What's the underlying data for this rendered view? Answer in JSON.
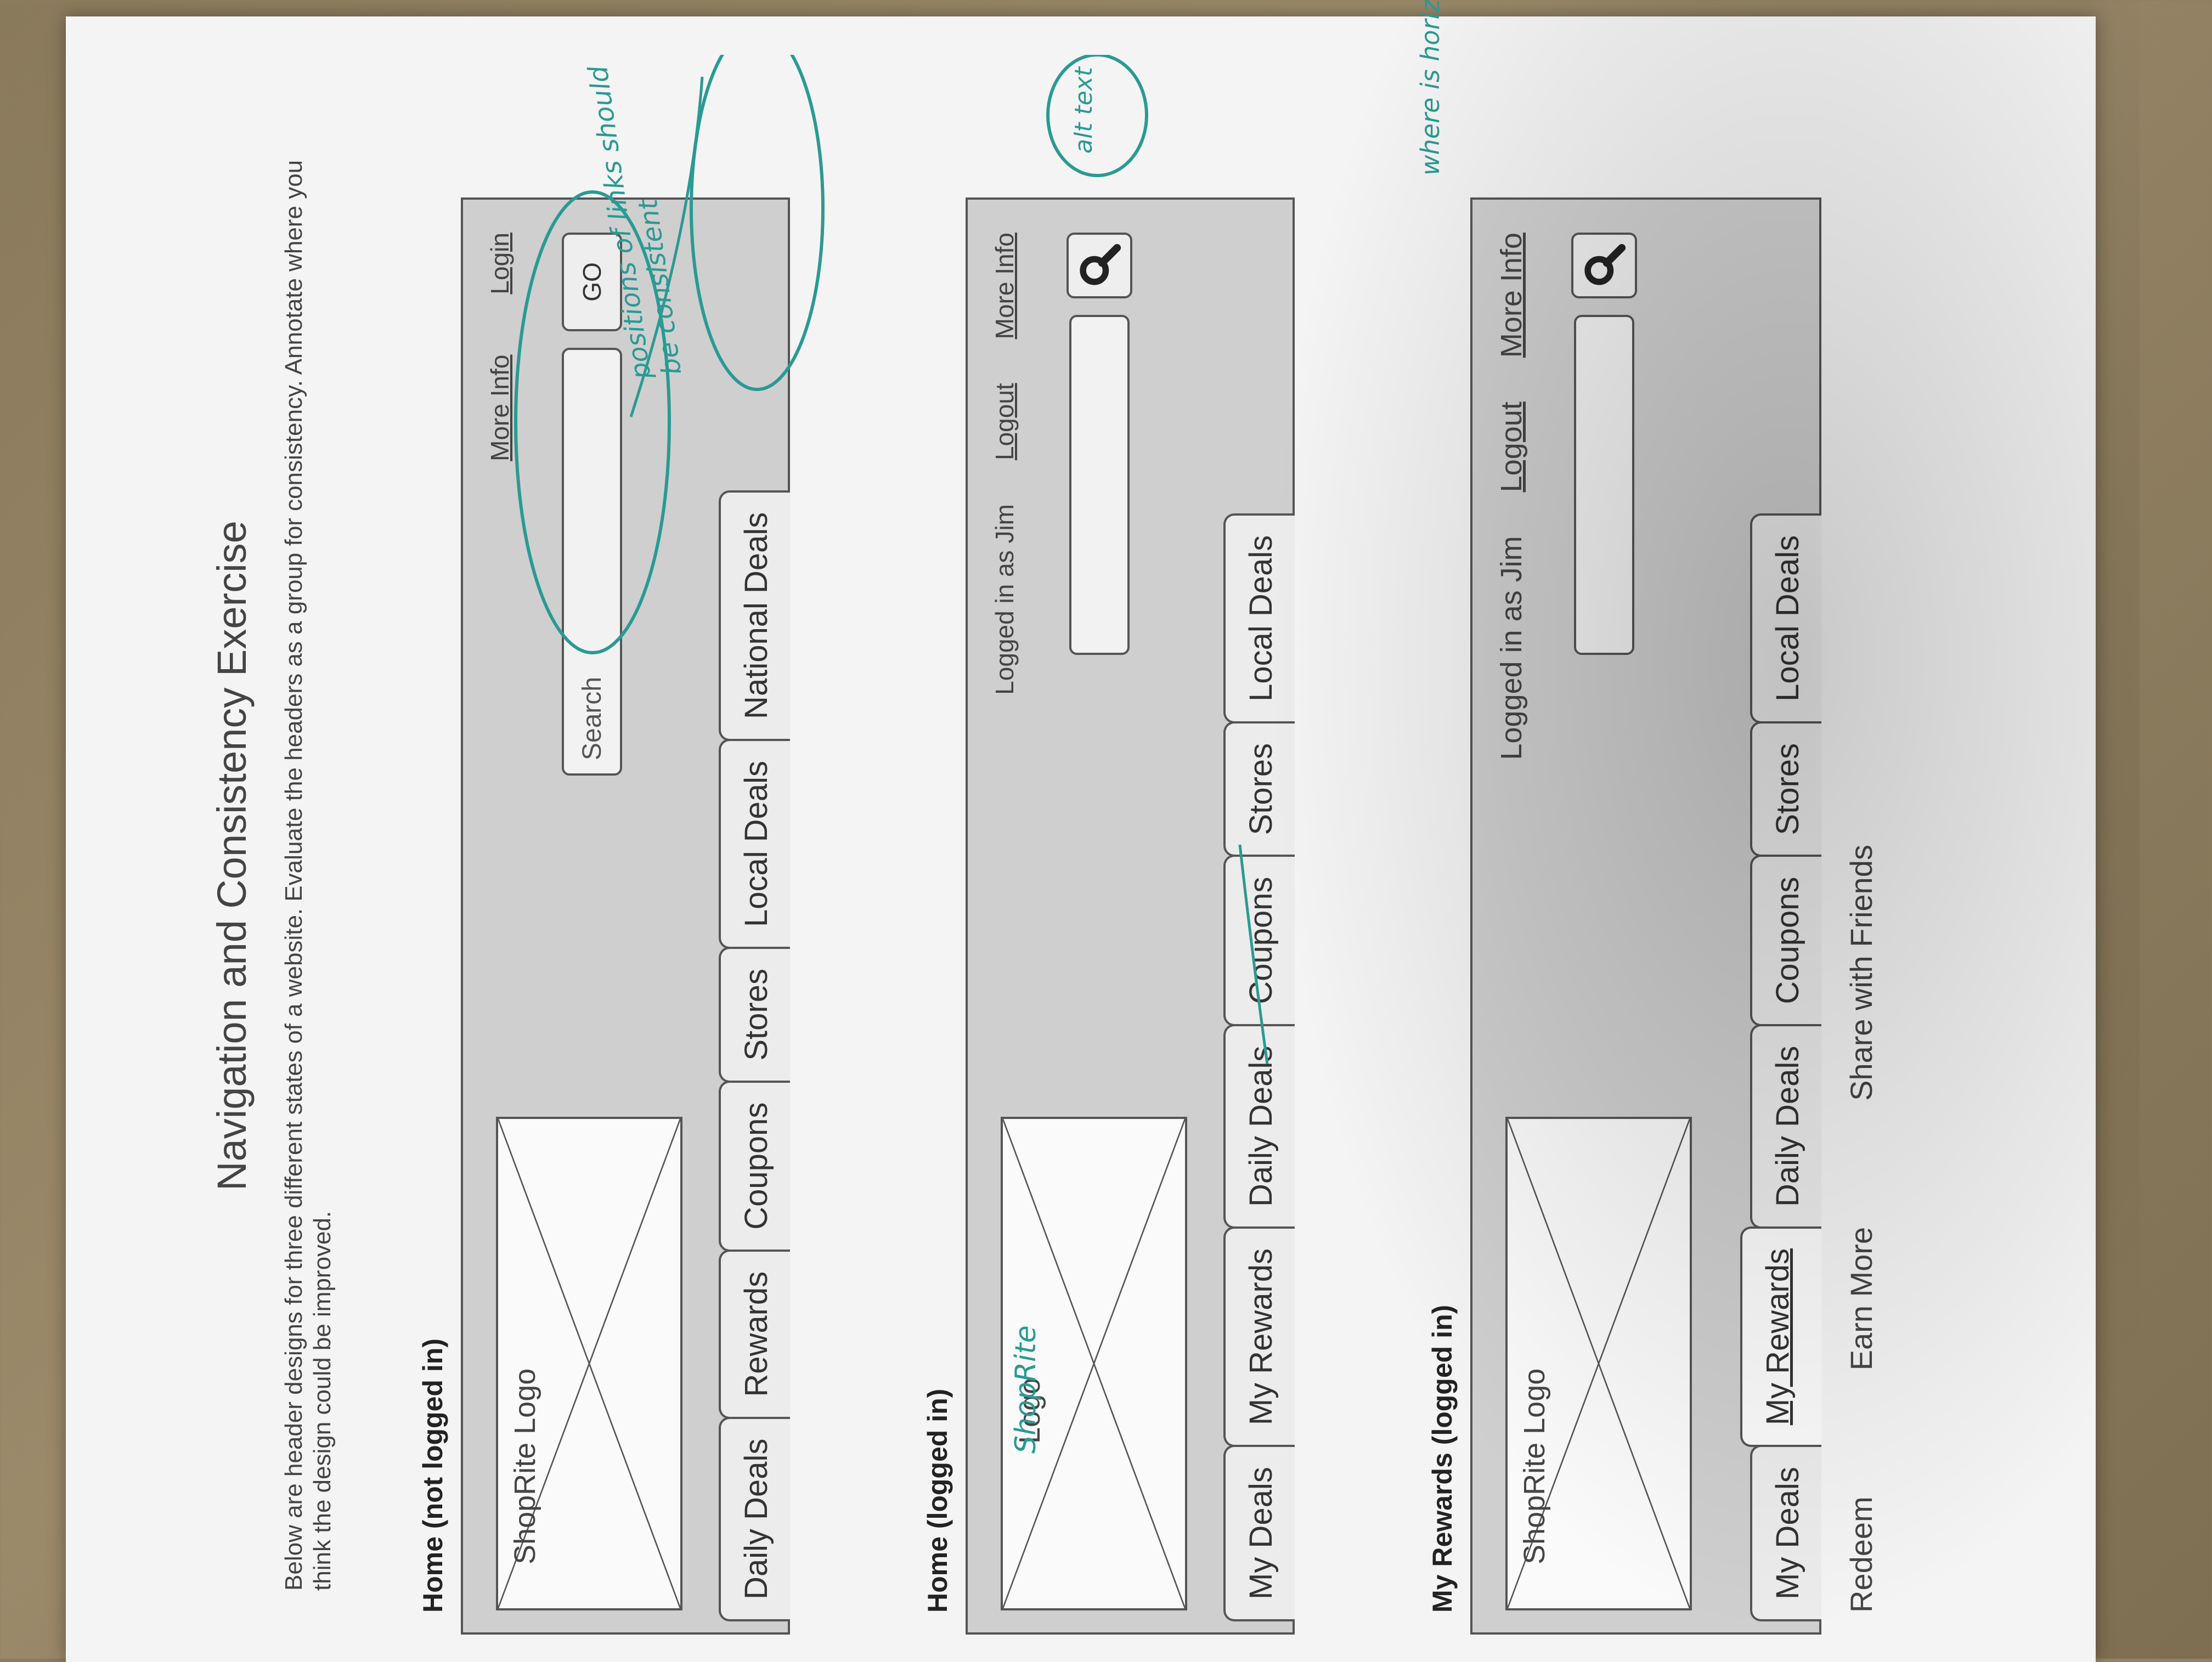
{
  "document": {
    "title": "Navigation and Consistency Exercise",
    "intro": "Below are header designs for three different states of a website. Evaluate the headers as a group for consistency. Annotate where you think the design could be improved."
  },
  "sections": [
    {
      "heading": "Home (not logged in)",
      "logo_label": "ShopRite Logo",
      "links": [
        "More Info",
        "Login"
      ],
      "search_placeholder": "Search",
      "go_label": "GO",
      "tabs": [
        "Daily Deals",
        "Rewards",
        "Coupons",
        "Stores",
        "Local Deals",
        "National Deals"
      ]
    },
    {
      "heading": "Home (logged in)",
      "logo_label": "Logo",
      "status_text": "Logged in as Jim",
      "links": [
        "Logout",
        "More Info"
      ],
      "search_icon": "magnifier-icon",
      "tabs": [
        "My Deals",
        "My Rewards",
        "Daily Deals",
        "Coupons",
        "Stores",
        "Local Deals"
      ]
    },
    {
      "heading": "My Rewards (logged in)",
      "logo_label": "ShopRite Logo",
      "status_text": "Logged in as Jim",
      "links": [
        "Logout",
        "More Info"
      ],
      "search_icon": "magnifier-icon",
      "tabs": [
        "My Deals",
        "My Rewards",
        "Daily Deals",
        "Coupons",
        "Stores",
        "Local Deals"
      ],
      "active_tab": "My Rewards",
      "subnav": [
        "Redeem",
        "Earn More",
        "Share with Friends"
      ]
    }
  ],
  "annotations": {
    "note1": "positions of links should be consistent",
    "note2": "ShopRite",
    "note3": "alt text",
    "note4": "where is horizontal deal"
  },
  "colors": {
    "annotation_ink": "#2a9a93",
    "header_fill": "#cfcfcf"
  }
}
